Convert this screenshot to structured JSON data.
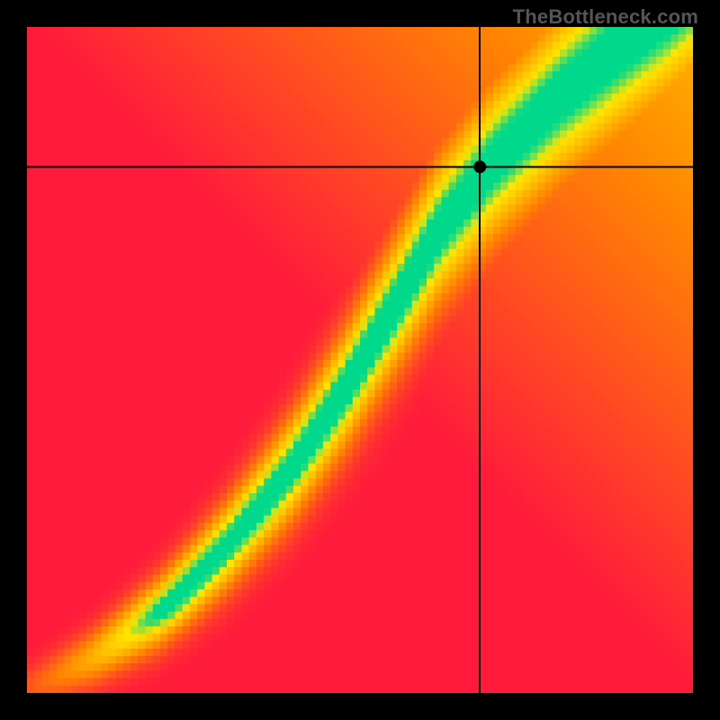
{
  "watermark": "TheBottleneck.com",
  "colors": {
    "red": "#ff1a3c",
    "orange": "#ff8a00",
    "yellow": "#ffe600",
    "green": "#00d98b"
  },
  "chart_data": {
    "type": "heatmap",
    "title": "",
    "xlabel": "",
    "ylabel": "",
    "xlim": [
      0,
      100
    ],
    "ylim": [
      0,
      100
    ],
    "crosshair": {
      "x": 68,
      "y": 79
    },
    "marker": {
      "x": 68,
      "y": 79
    },
    "optimal_band": {
      "description": "green optimal ridge of the heatmap, y as function of x",
      "points": [
        {
          "x": 0,
          "y": 0
        },
        {
          "x": 10,
          "y": 5
        },
        {
          "x": 20,
          "y": 12
        },
        {
          "x": 30,
          "y": 22
        },
        {
          "x": 40,
          "y": 34
        },
        {
          "x": 48,
          "y": 46
        },
        {
          "x": 55,
          "y": 58
        },
        {
          "x": 62,
          "y": 70
        },
        {
          "x": 70,
          "y": 80
        },
        {
          "x": 80,
          "y": 90
        },
        {
          "x": 92,
          "y": 100
        }
      ],
      "half_width_start": 1.5,
      "half_width_end": 7
    },
    "corner_values": {
      "description": "approximate score (0 worst red, 100 best green) at corners",
      "bottom_left": 5,
      "bottom_right": 0,
      "top_left": 0,
      "top_right": 60
    },
    "pixelation": 90
  }
}
